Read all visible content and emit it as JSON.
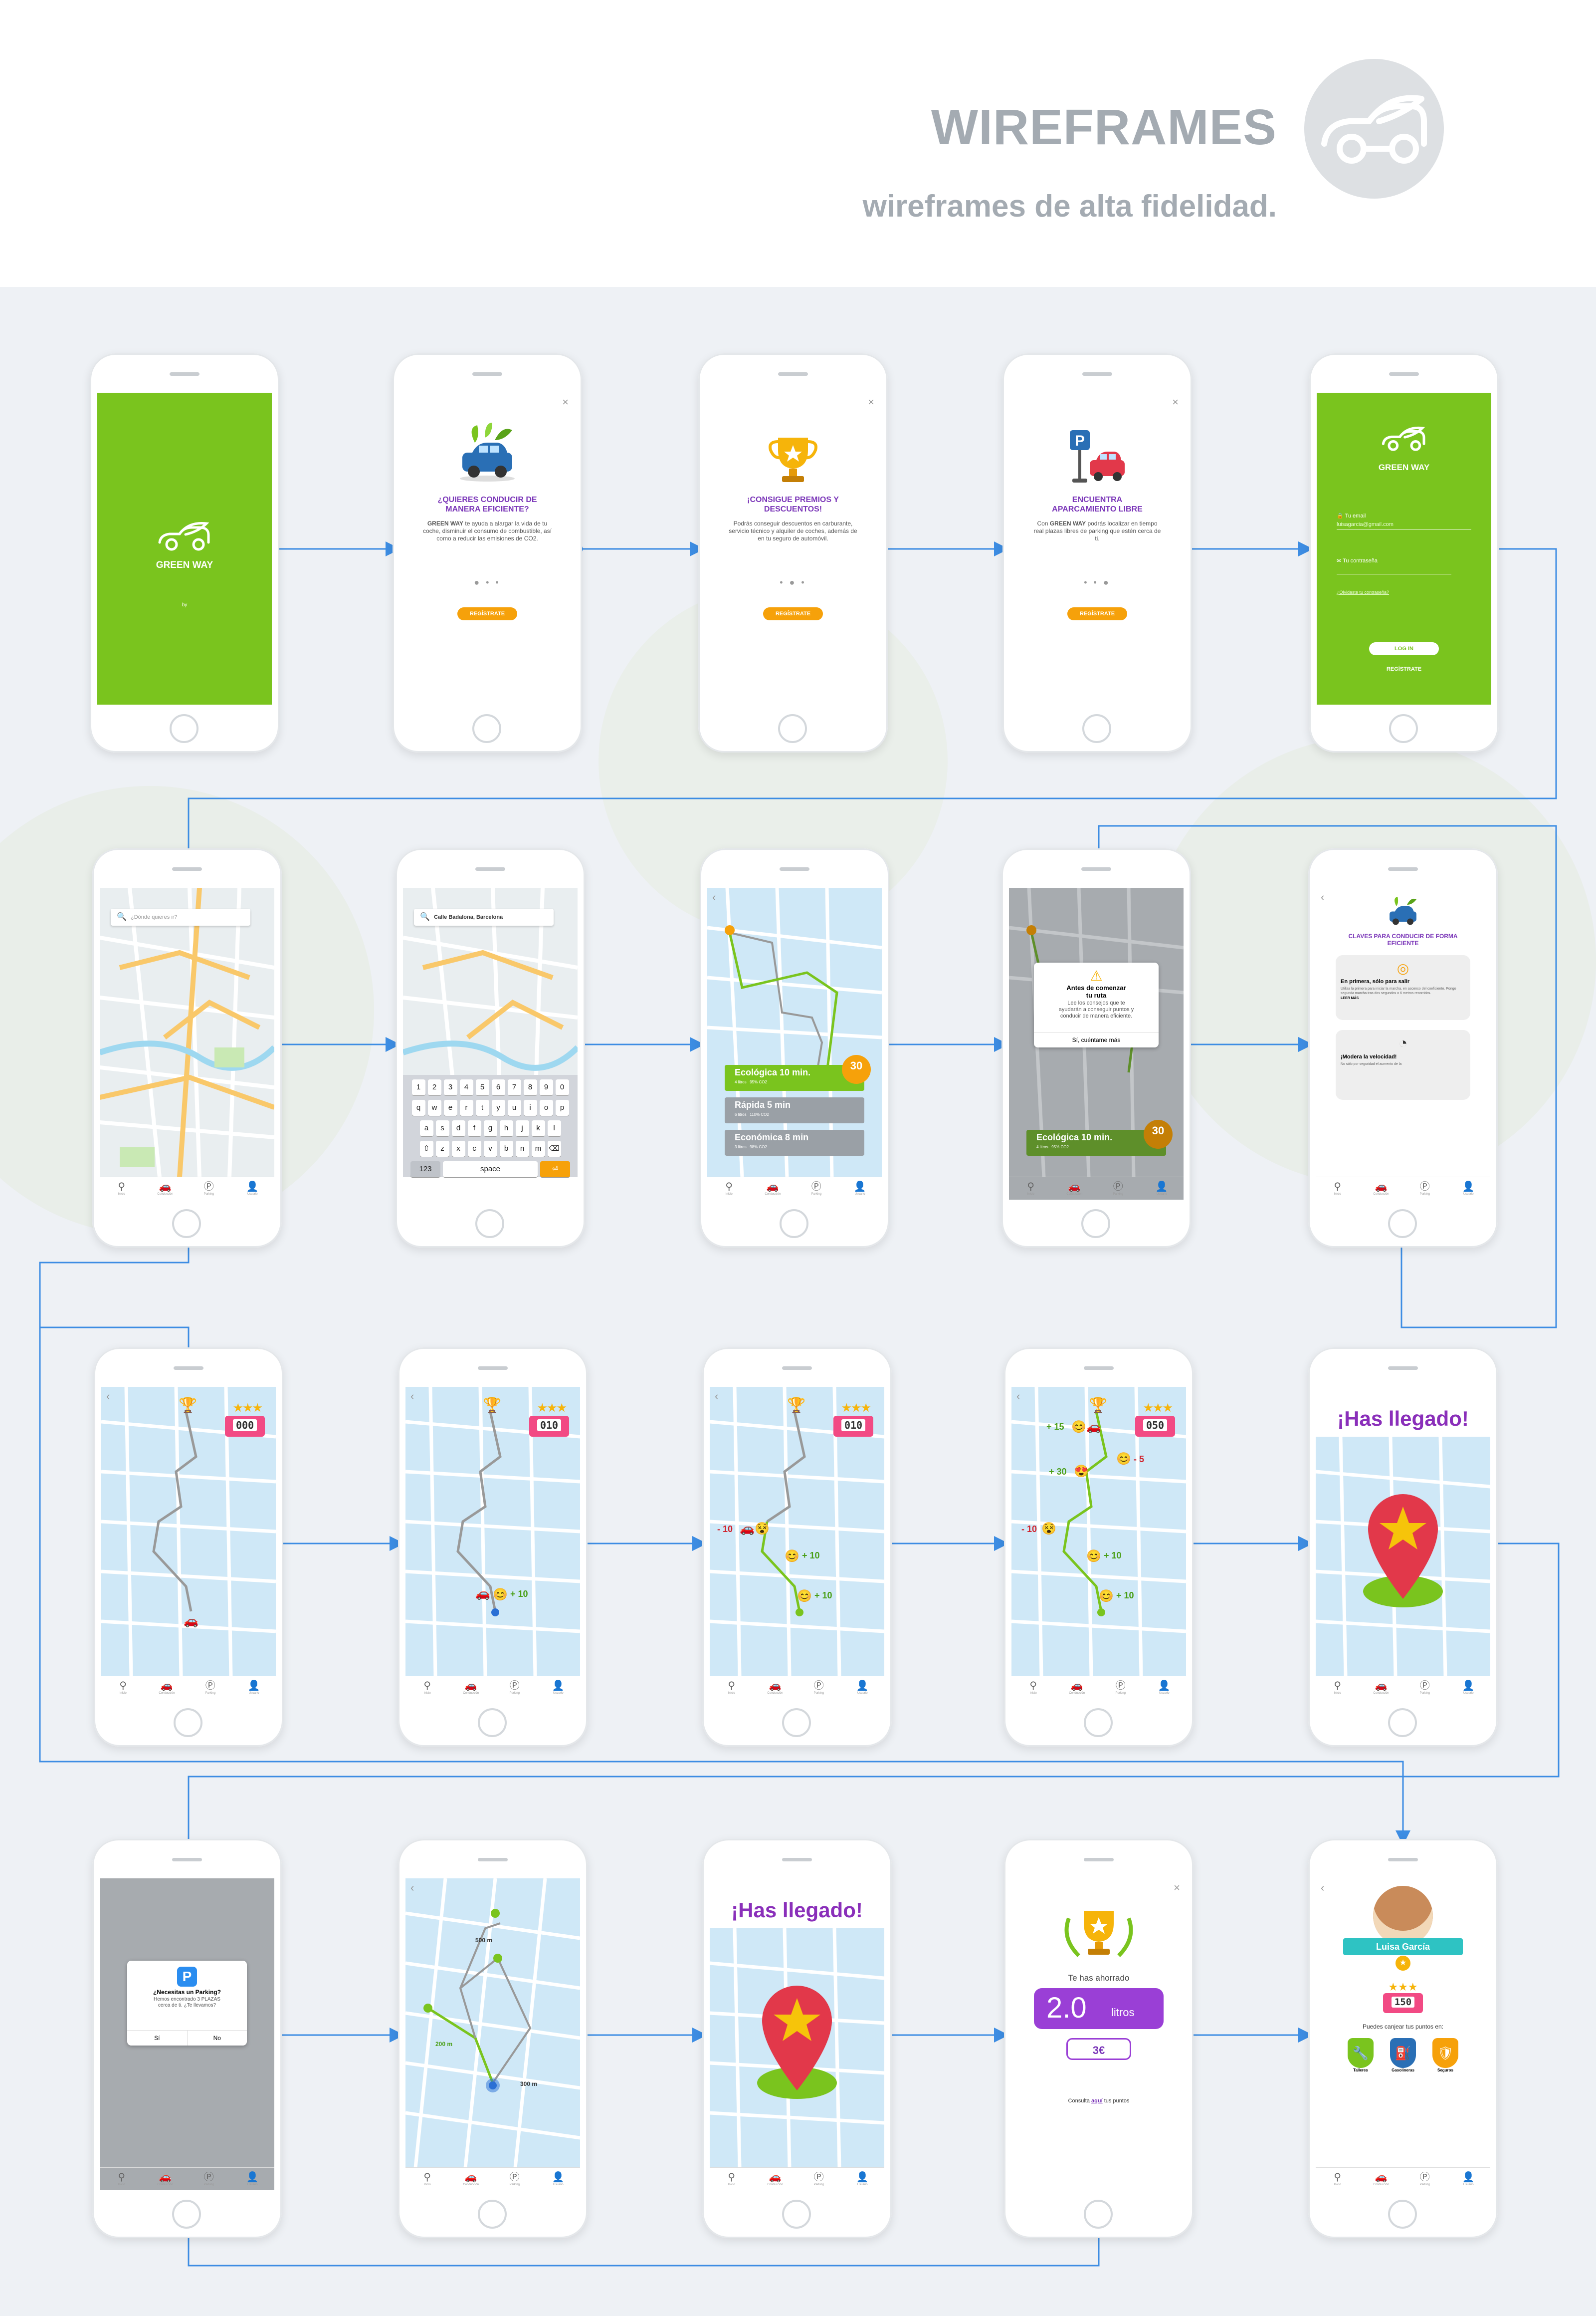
{
  "header": {
    "title": "WIREFRAMES",
    "subtitle": "wireframes de alta fidelidad."
  },
  "colors": {
    "green": "#7ac41e",
    "purple": "#7a35b8",
    "orange": "#f6a10a",
    "link_blue": "#3d8de3",
    "pink": "#f24a84"
  },
  "common": {
    "tabs": [
      "Inicio",
      "Conducción",
      "Parking",
      "Usuario"
    ],
    "tab_icons": [
      "pin-icon",
      "car-icon",
      "parking-icon",
      "user-icon"
    ]
  },
  "splash": {
    "brand": "GREEN WAY",
    "by": "by"
  },
  "onboard1": {
    "title": "¿QUIERES CONDUCIR DE MANERA EFICIENTE?",
    "brand": "GREEN WAY",
    "text": "te ayuda a alargar la vida de tu coche, disminuir el consumo de combustible, así como a reducir las emisiones de CO2.",
    "dots": "● • •",
    "button": "REGÍSTRATE"
  },
  "onboard2": {
    "title": "¡CONSIGUE PREMIOS Y DESCUENTOS!",
    "text": "Podrás conseguir descuentos en carburante, servicio técnico y alquiler de coches, además de en tu seguro de automóvil.",
    "dots": "• ● •",
    "button": "REGÍSTRATE"
  },
  "onboard3": {
    "title": "ENCUENTRA APARCAMIENTO LIBRE",
    "text_prefix": "Con",
    "brand": "GREEN WAY",
    "text": "podrás localizar en tiempo real plazas libres de parking que estén cerca de ti.",
    "dots": "• • ●",
    "button": "REGÍSTRATE"
  },
  "login": {
    "brand": "GREEN WAY",
    "email_label": "Tu email",
    "email_value": "luisagarcia@gmail.com",
    "pass_label": "Tu contraseña",
    "forgot": "¿Olvidaste tu contraseña?",
    "login_button": "LOG IN",
    "register": "REGÍSTRATE"
  },
  "map1": {
    "search_placeholder": "¿Dónde quieres ir?"
  },
  "map2": {
    "search_value": "Calle Badalona, Barcelona",
    "rows": [
      [
        "1",
        "2",
        "3",
        "4",
        "5",
        "6",
        "7",
        "8",
        "9",
        "0"
      ],
      [
        "q",
        "w",
        "e",
        "r",
        "t",
        "y",
        "u",
        "i",
        "o",
        "p"
      ],
      [
        "a",
        "s",
        "d",
        "f",
        "g",
        "h",
        "j",
        "k",
        "l"
      ],
      [
        "⇧",
        "z",
        "x",
        "c",
        "v",
        "b",
        "n",
        "m",
        "⌫"
      ]
    ],
    "k123": "123",
    "space": "space",
    "go": "⏎"
  },
  "routes": {
    "badge": "30",
    "items": [
      {
        "name": "Ecológica",
        "time": "10 min.",
        "sub": "4 litros",
        "co2": "95% CO2"
      },
      {
        "name": "Rápida",
        "time": "5 min",
        "sub": "6 litros",
        "co2": "110% CO2"
      },
      {
        "name": "Económica",
        "time": "8 min",
        "sub": "3 litros",
        "co2": "98% CO2"
      }
    ]
  },
  "beforeRoute": {
    "title": "Antes de comenzar tu ruta",
    "text": "Lee los consejos que te ayudarán a conseguir puntos y conducir de manera eficiente.",
    "button": "Sí, cuéntame más"
  },
  "tips": {
    "title": "CLAVES PARA CONDUCIR DE FORMA EFICIENTE",
    "tip1_title": "En primera, sólo para salir",
    "tip1_text": "Utiliza la primera para iniciar la marcha, en ascenso del coeficiente. Pongo segunda marcha tras dos segundos o 6 metros recorridos.",
    "read_more": "LEER MÁS",
    "tip2_title": "¡Modera la velocidad!",
    "tip2_text": "No sólo por seguridad el aumento de la"
  },
  "drive": {
    "scores": [
      "000",
      "010",
      "010",
      "050"
    ],
    "plus10": "+ 10",
    "minus10": "- 10",
    "plus15": "+ 15",
    "plus30": "+ 30",
    "minus5": "- 5"
  },
  "arrived": {
    "title": "¡Has llegado!"
  },
  "parking": {
    "title": "¿Necesitas un Parking?",
    "text": "Hemos encontrado 3 PLAZAS cerca de ti. ¿Te llevamos?",
    "yes": "Sí",
    "no": "No"
  },
  "parkRoute": {
    "d1": "500 m",
    "d2": "200 m",
    "d3": "300 m"
  },
  "saved": {
    "label": "Te has ahorrado",
    "value": "2.0",
    "unit": "litros",
    "money": "3€",
    "footer_prefix": "Consulta",
    "footer_link": "aquí",
    "footer_suffix": "tus puntos"
  },
  "profile": {
    "name": "Luisa García",
    "score": "150",
    "redeem": "Puedes canjear tus puntos en:",
    "partners": [
      "Talleres",
      "Gasolineras",
      "Seguros"
    ]
  }
}
